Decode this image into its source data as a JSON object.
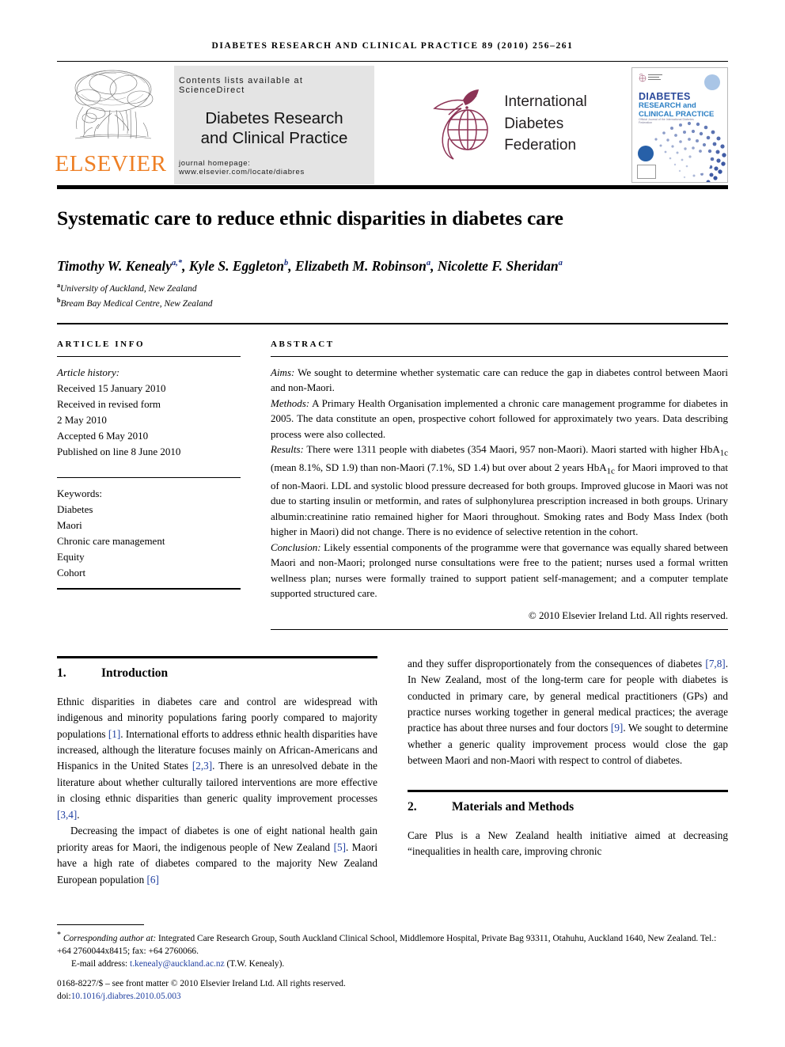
{
  "running_head": "Diabetes research and clinical practice 89 (2010) 256–261",
  "masthead": {
    "publisher_logo_word": "ELSEVIER",
    "contents_line": "Contents lists available at ScienceDirect",
    "journal_title_line1": "Diabetes Research",
    "journal_title_line2": "and Clinical Practice",
    "homepage_line": "journal homepage: www.elsevier.com/locate/diabres",
    "society_line1": "International",
    "society_line2": "Diabetes",
    "society_line3": "Federation",
    "cover": {
      "title": "DIABETES",
      "subtitle": "RESEARCH and CLINICAL PRACTICE",
      "strapline": "Official Journal of the International Diabetes Federation"
    }
  },
  "article": {
    "title": "Systematic care to reduce ethnic disparities in diabetes care",
    "authors": "Timothy W. Kenealy a,*, Kyle S. Eggleton b, Elizabeth M. Robinson a, Nicolette F. Sheridan a",
    "affiliation_a": "University of Auckland, New Zealand",
    "affiliation_b": "Bream Bay Medical Centre, New Zealand"
  },
  "article_info": {
    "label": "Article info",
    "history_label": "Article history:",
    "history": [
      "Received 15 January 2010",
      "Received in revised form",
      "2 May 2010",
      "Accepted 6 May 2010",
      "Published on line 8 June 2010"
    ],
    "keywords_label": "Keywords:",
    "keywords": [
      "Diabetes",
      "Maori",
      "Chronic care management",
      "Equity",
      "Cohort"
    ]
  },
  "abstract": {
    "label": "Abstract",
    "aims_label": "Aims:",
    "aims_text": " We sought to determine whether systematic care can reduce the gap in diabetes control between Maori and non-Maori.",
    "methods_label": "Methods:",
    "methods_text": " A Primary Health Organisation implemented a chronic care management programme for diabetes in 2005. The data constitute an open, prospective cohort followed for approximately two years. Data describing process were also collected.",
    "results_label": "Results:",
    "results_text_1": " There were 1311 people with diabetes (354 Maori, 957 non-Maori). Maori started with higher HbA",
    "results_sub_1": "1c",
    "results_text_2": " (mean 8.1%, SD 1.9) than non-Maori (7.1%, SD 1.4) but over about 2 years HbA",
    "results_sub_2": "1c",
    "results_text_3": " for Maori improved to that of non-Maori. LDL and systolic blood pressure decreased for both groups. Improved glucose in Maori was not due to starting insulin or metformin, and rates of sulphonylurea prescription increased in both groups. Urinary albumin:creatinine ratio remained higher for Maori throughout. Smoking rates and Body Mass Index (both higher in Maori) did not change. There is no evidence of selective retention in the cohort.",
    "conclusion_label": "Conclusion:",
    "conclusion_text": " Likely essential components of the programme were that governance was equally shared between Maori and non-Maori; prolonged nurse consultations were free to the patient; nurses used a formal written wellness plan; nurses were formally trained to support patient self-management; and a computer template supported structured care.",
    "copyright": "© 2010 Elsevier Ireland Ltd. All rights reserved."
  },
  "sections": {
    "intro": {
      "number": "1.",
      "title": "Introduction",
      "p1_a": "Ethnic disparities in diabetes care and control are widespread with indigenous and minority populations faring poorly compared to majority populations ",
      "p1_cite1": "[1]",
      "p1_b": ". International efforts to address ethnic health disparities have increased, although the literature focuses mainly on African-Americans and Hispanics in the United States ",
      "p1_cite2": "[2,3]",
      "p1_c": ". There is an unresolved debate in the literature about whether culturally tailored interventions are more effective in closing ethnic disparities than generic quality improvement processes ",
      "p1_cite3": "[3,4]",
      "p1_d": ".",
      "p2_a": "Decreasing the impact of diabetes is one of eight national health gain priority areas for Maori, the indigenous people of New Zealand ",
      "p2_cite1": "[5]",
      "p2_b": ". Maori have a high rate of diabetes compared to the majority New Zealand European population ",
      "p2_cite2": "[6]",
      "p2_c": " and they suffer disproportionately from the consequences of diabetes ",
      "p2_cite3": "[7,8]",
      "p2_d": ". In New Zealand, most of the long-term care for people with diabetes is conducted in primary care, by general medical practitioners (GPs) and practice nurses working together in general medical practices; the average practice has about three nurses and four doctors ",
      "p2_cite4": "[9]",
      "p2_e": ". We sought to determine whether a generic quality improvement process would close the gap between Maori and non-Maori with respect to control of diabetes."
    },
    "methods": {
      "number": "2.",
      "title": "Materials and Methods",
      "p1": "Care Plus is a New Zealand health initiative aimed at decreasing “inequalities in health care, improving chronic"
    }
  },
  "footnotes": {
    "corresponding_star": "*",
    "corresponding_label": "Corresponding author at:",
    "corresponding_text": " Integrated Care Research Group, South Auckland Clinical School, Middlemore Hospital, Private Bag 93311, Otahuhu, Auckland 1640, New Zealand. Tel.: +64 2760044x8415; fax: +64 2760066.",
    "email_label": "E-mail address:",
    "email": "t.kenealy@auckland.ac.nz",
    "email_attrib": " (T.W. Kenealy).",
    "issn_line": "0168-8227/$ – see front matter © 2010 Elsevier Ireland Ltd. All rights reserved.",
    "doi_prefix": "doi:",
    "doi": "10.1016/j.diabres.2010.05.003"
  },
  "colors": {
    "elsevier_orange": "#EE7F24",
    "idf_maroon": "#8C3355",
    "citation_blue": "#1F3FA0",
    "cover_blue": "#2B4A9B"
  }
}
